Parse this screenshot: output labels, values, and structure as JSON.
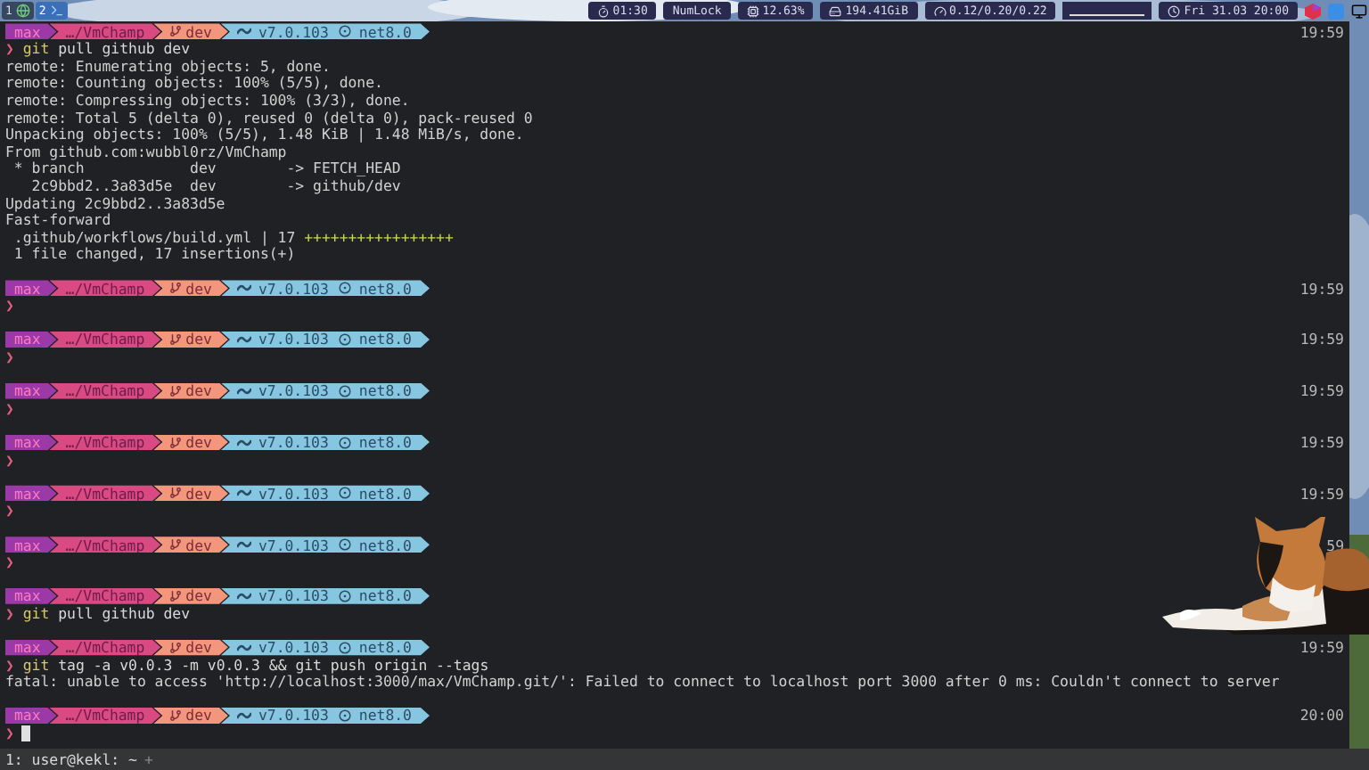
{
  "top_bar": {
    "workspaces": [
      {
        "label": "1",
        "selected": false,
        "kind": "browser"
      },
      {
        "label": "2",
        "selected": true,
        "kind": "terminal"
      }
    ],
    "modules": [
      {
        "kind": "uptime",
        "text": "01:30"
      },
      {
        "kind": "numlock",
        "text": "NumLock"
      },
      {
        "kind": "cpu",
        "text": "12.63%"
      },
      {
        "kind": "disk",
        "text": "194.41GiB"
      },
      {
        "kind": "load",
        "text": "0.12/0.20/0.22"
      },
      {
        "kind": "bar"
      },
      {
        "kind": "clock",
        "text": "Fri 31.03 20:00"
      }
    ]
  },
  "terminal": {
    "blocks": [
      {
        "prompt": {
          "user": "max",
          "path": "…/VmChamp",
          "branch": "dev",
          "sdk": "v7.0.103",
          "framework": "net8.0"
        },
        "time": "19:59",
        "symbol": "❯",
        "command": "git pull github dev",
        "output": [
          {
            "text": "remote: Enumerating objects: 5, done."
          },
          {
            "text": "remote: Counting objects: 100% (5/5), done."
          },
          {
            "text": "remote: Compressing objects: 100% (3/3), done."
          },
          {
            "text": "remote: Total 5 (delta 0), reused 0 (delta 0), pack-reused 0"
          },
          {
            "text": "Unpacking objects: 100% (5/5), 1.48 KiB | 1.48 MiB/s, done."
          },
          {
            "text": "From github.com:wubbl0rz/VmChamp"
          },
          {
            "text": " * branch            dev        -> FETCH_HEAD"
          },
          {
            "text": "   2c9bbd2..3a83d5e  dev        -> github/dev"
          },
          {
            "text": "Updating 2c9bbd2..3a83d5e"
          },
          {
            "text": "Fast-forward"
          },
          {
            "text": " .github/workflows/build.yml | 17 ",
            "plus": "+++++++++++++++++"
          },
          {
            "text": " 1 file changed, 17 insertions(+)"
          }
        ]
      },
      {
        "prompt": {
          "user": "max",
          "path": "…/VmChamp",
          "branch": "dev",
          "sdk": "v7.0.103",
          "framework": "net8.0"
        },
        "time": "19:59",
        "symbol": "❯"
      },
      {
        "prompt": {
          "user": "max",
          "path": "…/VmChamp",
          "branch": "dev",
          "sdk": "v7.0.103",
          "framework": "net8.0"
        },
        "time": "19:59",
        "symbol": "❯"
      },
      {
        "prompt": {
          "user": "max",
          "path": "…/VmChamp",
          "branch": "dev",
          "sdk": "v7.0.103",
          "framework": "net8.0"
        },
        "time": "19:59",
        "symbol": "❯"
      },
      {
        "prompt": {
          "user": "max",
          "path": "…/VmChamp",
          "branch": "dev",
          "sdk": "v7.0.103",
          "framework": "net8.0"
        },
        "time": "19:59",
        "symbol": "❯"
      },
      {
        "prompt": {
          "user": "max",
          "path": "…/VmChamp",
          "branch": "dev",
          "sdk": "v7.0.103",
          "framework": "net8.0"
        },
        "time": "19:59",
        "symbol": "❯"
      },
      {
        "prompt": {
          "user": "max",
          "path": "…/VmChamp",
          "branch": "dev",
          "sdk": "v7.0.103",
          "framework": "net8.0"
        },
        "time": "59",
        "symbol": "❯"
      },
      {
        "prompt": {
          "user": "max",
          "path": "…/VmChamp",
          "branch": "dev",
          "sdk": "v7.0.103",
          "framework": "net8.0"
        },
        "symbol": "❯",
        "command": "git pull github dev"
      },
      {
        "prompt": {
          "user": "max",
          "path": "…/VmChamp",
          "branch": "dev",
          "sdk": "v7.0.103",
          "framework": "net8.0"
        },
        "time": "19:59",
        "symbol": "❯",
        "command": "git tag -a v0.0.3 -m v0.0.3 && git push origin --tags",
        "output": [
          {
            "text": "fatal: unable to access 'http://localhost:3000/max/VmChamp.git/': Failed to connect to localhost port 3000 after 0 ms: Couldn't connect to server"
          }
        ]
      },
      {
        "prompt": {
          "user": "max",
          "path": "…/VmChamp",
          "branch": "dev",
          "sdk": "v7.0.103",
          "framework": "net8.0"
        },
        "time": "20:00",
        "symbol": "❯",
        "cursor": true
      }
    ]
  },
  "status_bar": {
    "window": "1: user@kekl: ~",
    "new": "+"
  }
}
